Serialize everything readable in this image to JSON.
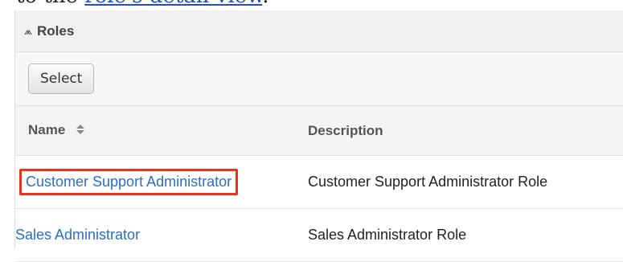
{
  "doc": {
    "prefix": "to the ",
    "link": "role's detail view",
    "suffix": "."
  },
  "subpanel": {
    "title": "Roles",
    "select_label": "Select"
  },
  "table": {
    "headers": [
      "Name",
      "Description"
    ],
    "rows": [
      {
        "name": "Customer Support Administrator",
        "description": "Customer Support Administrator Role"
      },
      {
        "name": "Sales Administrator",
        "description": "Sales Administrator Role"
      }
    ]
  },
  "colors": {
    "link": "#2b6fc2",
    "highlight": "#e8321e"
  }
}
